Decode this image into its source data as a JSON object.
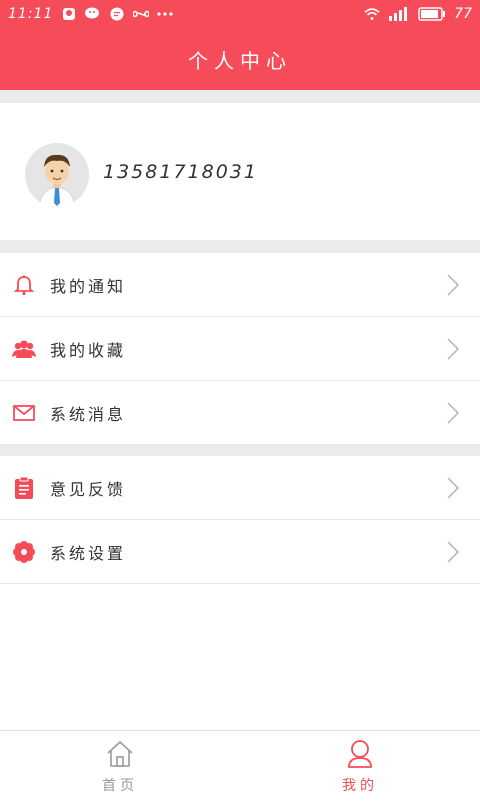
{
  "status_bar": {
    "time": "11:11",
    "battery": "77",
    "icons": [
      "app-icon",
      "wechat-icon",
      "message-icon",
      "infinity-icon",
      "more-dots-icon",
      "wifi-icon",
      "signal-icon",
      "battery-icon"
    ]
  },
  "header": {
    "title": "个人中心"
  },
  "profile": {
    "phone": "13581718031",
    "avatar_icon": "avatar-icon"
  },
  "menu_groups": [
    [
      {
        "label": "我的通知",
        "icon": "bell-icon"
      },
      {
        "label": "我的收藏",
        "icon": "users-icon"
      },
      {
        "label": "系统消息",
        "icon": "mail-icon"
      }
    ],
    [
      {
        "label": "意见反馈",
        "icon": "clipboard-icon"
      },
      {
        "label": "系统设置",
        "icon": "gear-icon"
      }
    ]
  ],
  "tabbar": {
    "tabs": [
      {
        "label": "首页",
        "icon": "home-icon",
        "active": false
      },
      {
        "label": "我的",
        "icon": "user-icon",
        "active": true
      }
    ]
  },
  "colors": {
    "accent": "#f64c5a",
    "inactive": "#999999",
    "background_gap": "#ebebeb"
  }
}
